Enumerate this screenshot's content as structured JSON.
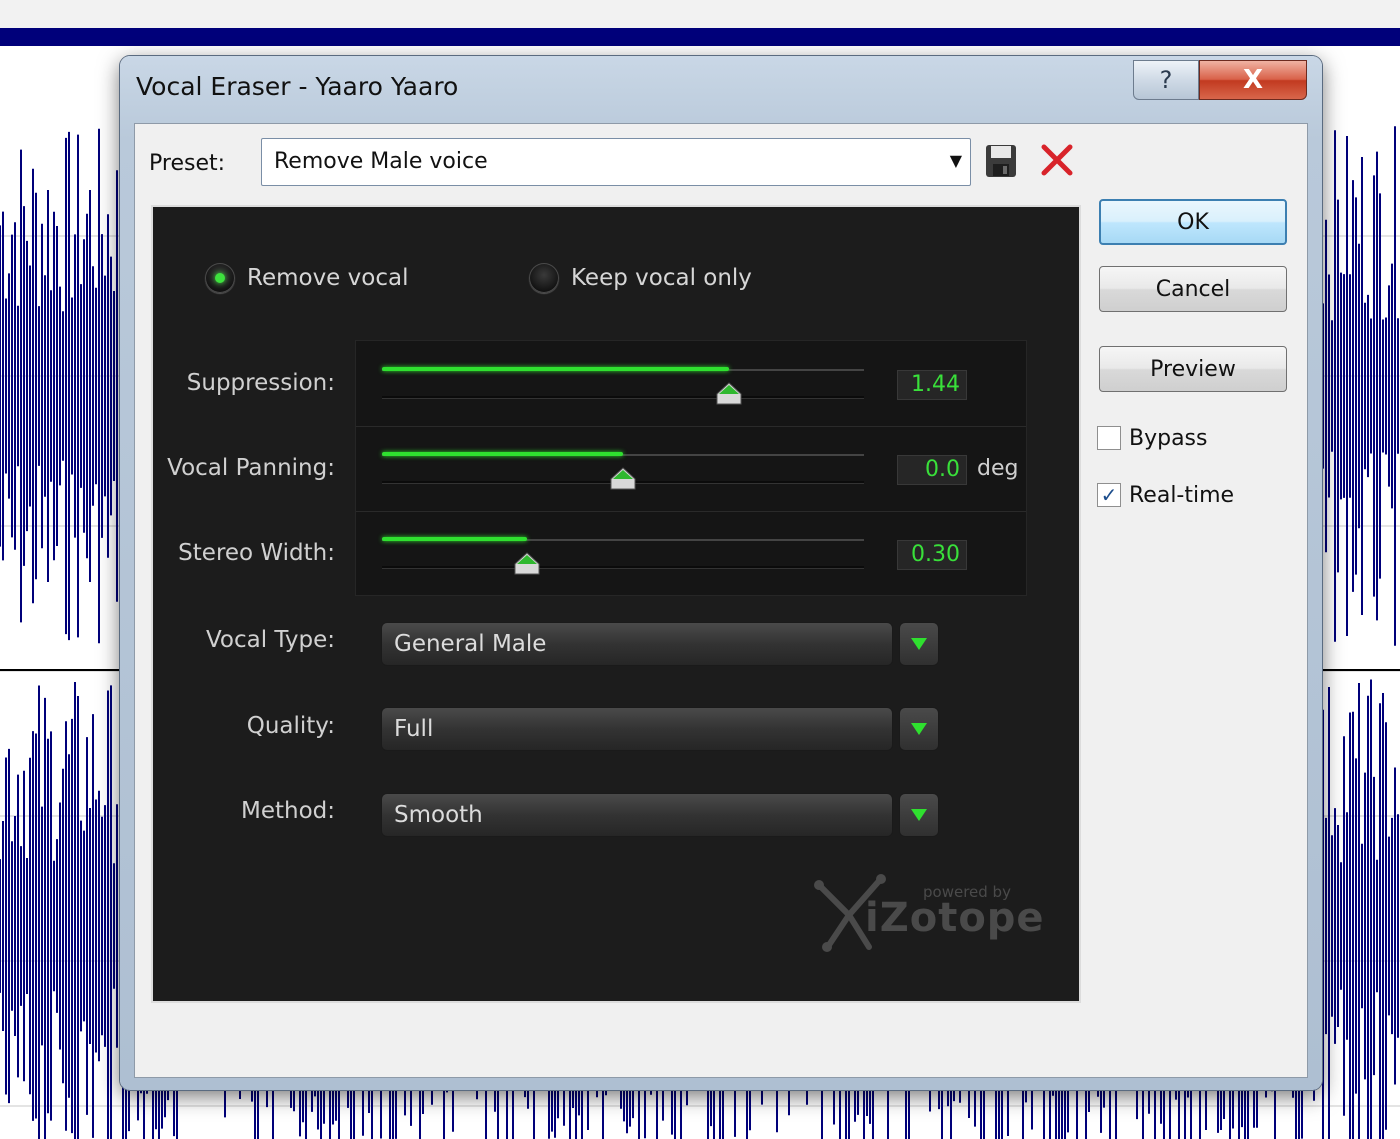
{
  "dialog": {
    "title": "Vocal Eraser - Yaaro Yaaro",
    "help_glyph": "?",
    "close_glyph": "X"
  },
  "preset": {
    "label": "Preset:",
    "value": "Remove Male voice"
  },
  "buttons": {
    "ok": "OK",
    "cancel": "Cancel",
    "preview": "Preview"
  },
  "checkboxes": [
    {
      "label": "Bypass",
      "checked": false
    },
    {
      "label": "Real-time",
      "checked": true
    }
  ],
  "mode": {
    "options": [
      {
        "label": "Remove vocal",
        "selected": true
      },
      {
        "label": "Keep vocal only",
        "selected": false
      }
    ]
  },
  "sliders": [
    {
      "label": "Suppression:",
      "value": "1.44",
      "unit": "",
      "fraction": 0.72
    },
    {
      "label": "Vocal Panning:",
      "value": "0.0",
      "unit": "deg",
      "fraction": 0.5
    },
    {
      "label": "Stereo Width:",
      "value": "0.30",
      "unit": "",
      "fraction": 0.3
    }
  ],
  "dropdowns": [
    {
      "label": "Vocal Type:",
      "value": "General Male"
    },
    {
      "label": "Quality:",
      "value": "Full"
    },
    {
      "label": "Method:",
      "value": "Smooth"
    }
  ],
  "logo": {
    "powered": "powered by",
    "name": "iZotope"
  },
  "colors": {
    "accent_green": "#2fe02f",
    "waveform": "#00007a",
    "panel_bg": "#1c1c1c"
  },
  "icons": {
    "save": "floppy-disk-icon",
    "delete": "red-x-icon",
    "dropdown": "green-triangle-icon"
  }
}
